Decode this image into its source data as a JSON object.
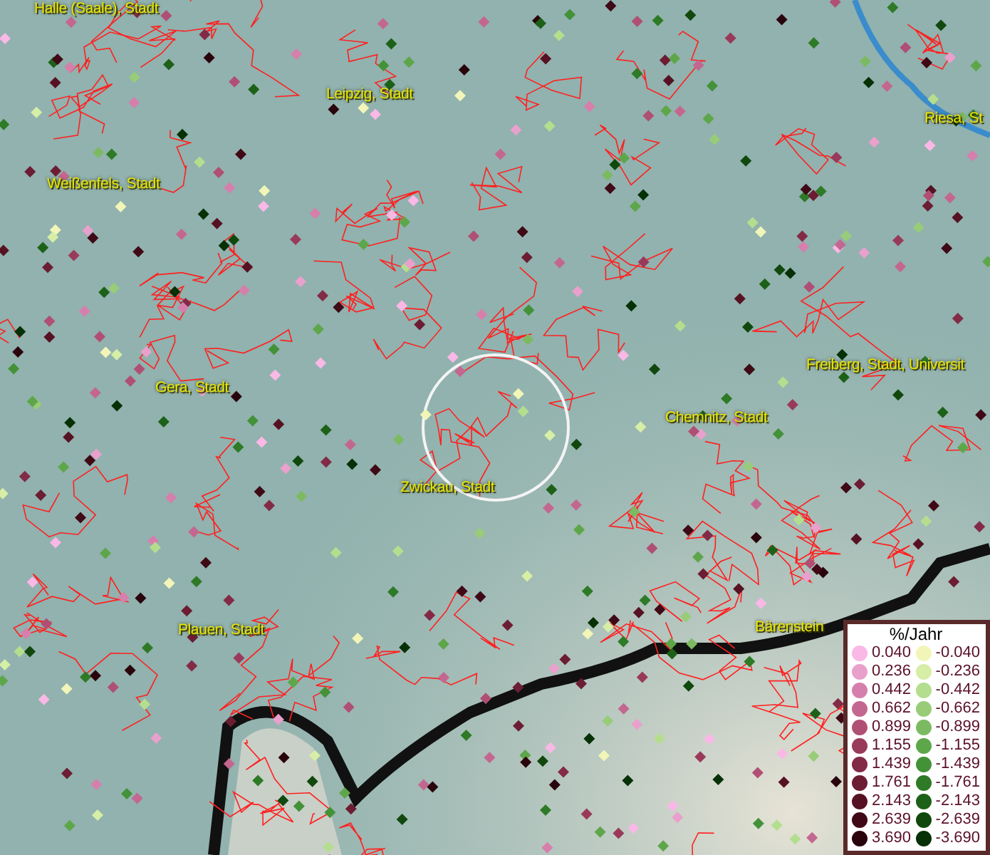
{
  "map": {
    "places": [
      {
        "label": "Halle (Saale), Stadt"
      },
      {
        "label": "Leipzig, Stadt"
      },
      {
        "label": "Riesa, St"
      },
      {
        "label": "Weißenfels, Stadt"
      },
      {
        "label": "Freiberg, Stadt, Universit"
      },
      {
        "label": "Gera, Stadt"
      },
      {
        "label": "Chemnitz, Stadt"
      },
      {
        "label": "Zwickau, Stadt"
      },
      {
        "label": "Plauen, Stadt"
      },
      {
        "label": "Bärenstein"
      }
    ]
  },
  "legend": {
    "title": "%/Jahr",
    "positive": [
      {
        "value": "0.040",
        "color": "#f9b8e6"
      },
      {
        "value": "0.236",
        "color": "#e9a0cc"
      },
      {
        "value": "0.442",
        "color": "#d67fac"
      },
      {
        "value": "0.662",
        "color": "#c46790"
      },
      {
        "value": "0.899",
        "color": "#b04f74"
      },
      {
        "value": "1.155",
        "color": "#9a3a5b"
      },
      {
        "value": "1.439",
        "color": "#832a47"
      },
      {
        "value": "1.761",
        "color": "#6c1d33"
      },
      {
        "value": "2.143",
        "color": "#561223"
      },
      {
        "value": "2.639",
        "color": "#3f0916"
      },
      {
        "value": "3.690",
        "color": "#2a040c"
      }
    ],
    "negative": [
      {
        "value": "-0.040",
        "color": "#f2f5b8"
      },
      {
        "value": "-0.236",
        "color": "#d6eea6"
      },
      {
        "value": "-0.442",
        "color": "#b4de8e"
      },
      {
        "value": "-0.662",
        "color": "#98cc78"
      },
      {
        "value": "-0.899",
        "color": "#7cba62"
      },
      {
        "value": "-1.155",
        "color": "#5ea64a"
      },
      {
        "value": "-1.439",
        "color": "#449238"
      },
      {
        "value": "-1.761",
        "color": "#2e7a26"
      },
      {
        "value": "-2.143",
        "color": "#1d6118"
      },
      {
        "value": "-2.639",
        "color": "#10480d"
      },
      {
        "value": "-3.690",
        "color": "#063005"
      }
    ]
  }
}
